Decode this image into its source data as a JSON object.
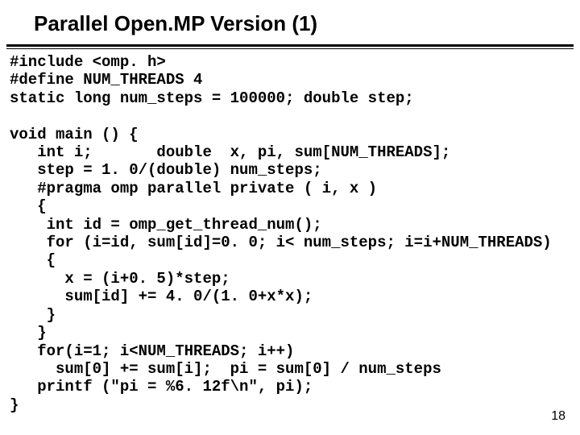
{
  "title": "Parallel Open.MP Version (1)",
  "code": "#include <omp. h>\n#define NUM_THREADS 4\nstatic long num_steps = 100000; double step;\n\nvoid main () {\n   int i;       double  x, pi, sum[NUM_THREADS];\n   step = 1. 0/(double) num_steps;\n   #pragma omp parallel private ( i, x )\n   {\n    int id = omp_get_thread_num();\n    for (i=id, sum[id]=0. 0; i< num_steps; i=i+NUM_THREADS)\n    {\n      x = (i+0. 5)*step;\n      sum[id] += 4. 0/(1. 0+x*x);\n    }\n   }\n   for(i=1; i<NUM_THREADS; i++)\n     sum[0] += sum[i];  pi = sum[0] / num_steps\n   printf (\"pi = %6. 12f\\n\", pi);\n}",
  "page_number": "18"
}
